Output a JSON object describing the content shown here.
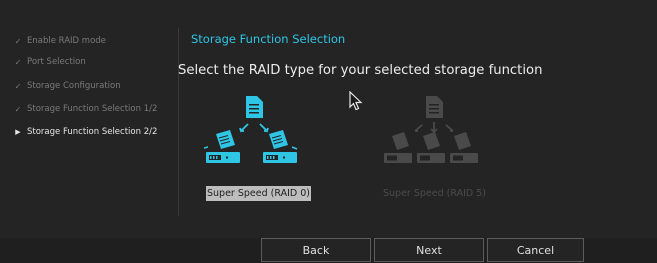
{
  "sidebar": {
    "items": [
      {
        "label": "Enable RAID mode",
        "state": "done"
      },
      {
        "label": "Port Selection",
        "state": "done"
      },
      {
        "label": "Storage Configuration",
        "state": "done"
      },
      {
        "label": "Storage Function Selection 1/2",
        "state": "done"
      },
      {
        "label": "Storage Function Selection 2/2",
        "state": "current"
      }
    ],
    "done_mark": "✓",
    "current_mark": "▶"
  },
  "main": {
    "title": "Storage Function Selection",
    "prompt": "Select the RAID type for your selected storage function",
    "options": [
      {
        "label": "Super Speed (RAID 0)",
        "selected": true,
        "enabled": true
      },
      {
        "label": "Super Speed (RAID 5)",
        "selected": false,
        "enabled": false
      }
    ]
  },
  "buttons": {
    "back": "Back",
    "next": "Next",
    "cancel": "Cancel"
  },
  "colors": {
    "accent": "#2fc6e6",
    "background": "#242424",
    "disabled_icon": "#4a4a4a"
  }
}
